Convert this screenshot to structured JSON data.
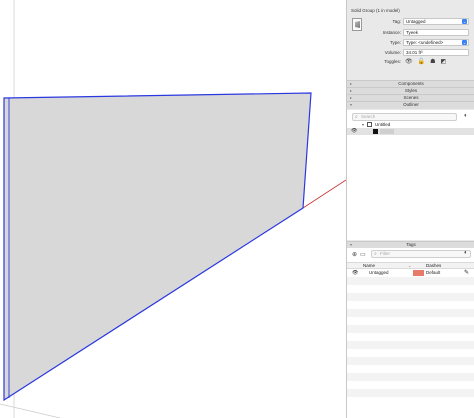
{
  "entity_info": {
    "title": "Solid Group (1 in model)",
    "tag_label": "Tag:",
    "tag_value": "Untagged",
    "instance_label": "Instance:",
    "instance_value": "Tyeek",
    "type_label": "Type:",
    "type_value": "Type: <undefined>",
    "volume_label": "Volume:",
    "volume_value": "34.01 ft³",
    "toggles_label": "Toggles:",
    "toggle_icons": [
      "visible-eye-icon",
      "lock-icon",
      "cast-shadows-icon",
      "receive-shadows-icon"
    ]
  },
  "trays": {
    "components": "Components",
    "styles": "Styles",
    "scenes": "Scenes",
    "outliner": "Outliner",
    "tags": "Tags"
  },
  "outliner": {
    "search_placeholder": "Search",
    "model_name": "Untitled",
    "rows": [
      {
        "name": "Tyeek",
        "selected": true
      }
    ]
  },
  "tags": {
    "filter_placeholder": "Filter",
    "col_name": "Name",
    "col_dashes": "Dashes",
    "rows": [
      {
        "name": "Untagged",
        "color": "#e87a6a",
        "dashes": "Default",
        "visible": true
      }
    ]
  },
  "colors": {
    "panel_bg": "#e9e9e9",
    "selection_blue": "#2b38e0",
    "axis_red": "#cc3333",
    "face_gray": "#d8d8d8",
    "accent": "#3b82f6"
  }
}
